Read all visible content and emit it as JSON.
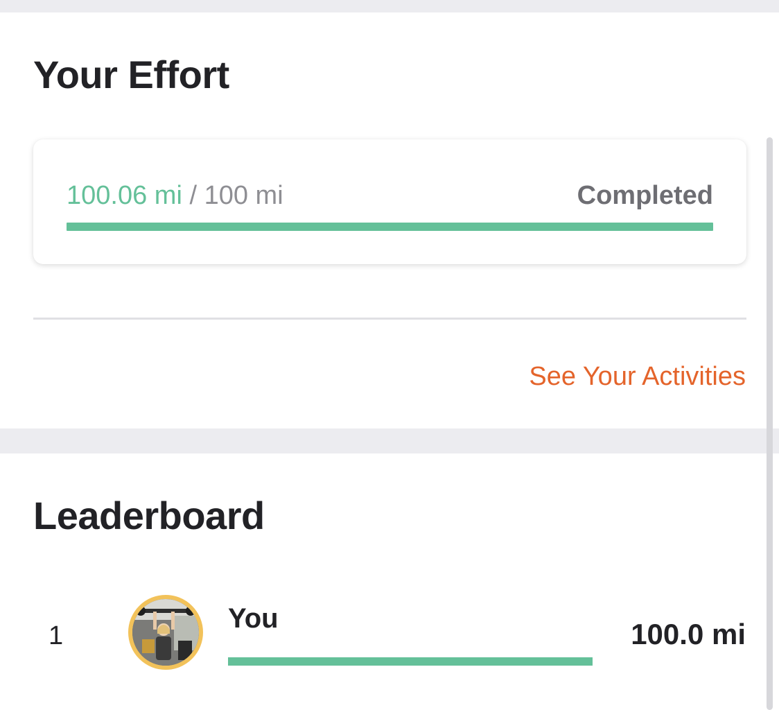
{
  "effort": {
    "title": "Your Effort",
    "current": "100.06 mi",
    "separator": " / ",
    "goal": "100 mi",
    "status": "Completed",
    "progress_fraction": 1.0,
    "link_label": "See Your Activities"
  },
  "leaderboard": {
    "title": "Leaderboard",
    "entries": [
      {
        "rank": "1",
        "name": "You",
        "value": "100.0 mi",
        "progress_fraction": 1.0
      }
    ]
  },
  "colors": {
    "accent_green": "#64c099",
    "link_orange": "#e4642b",
    "avatar_ring": "#f2c25a"
  },
  "icons": {
    "avatar": "user-photo"
  }
}
